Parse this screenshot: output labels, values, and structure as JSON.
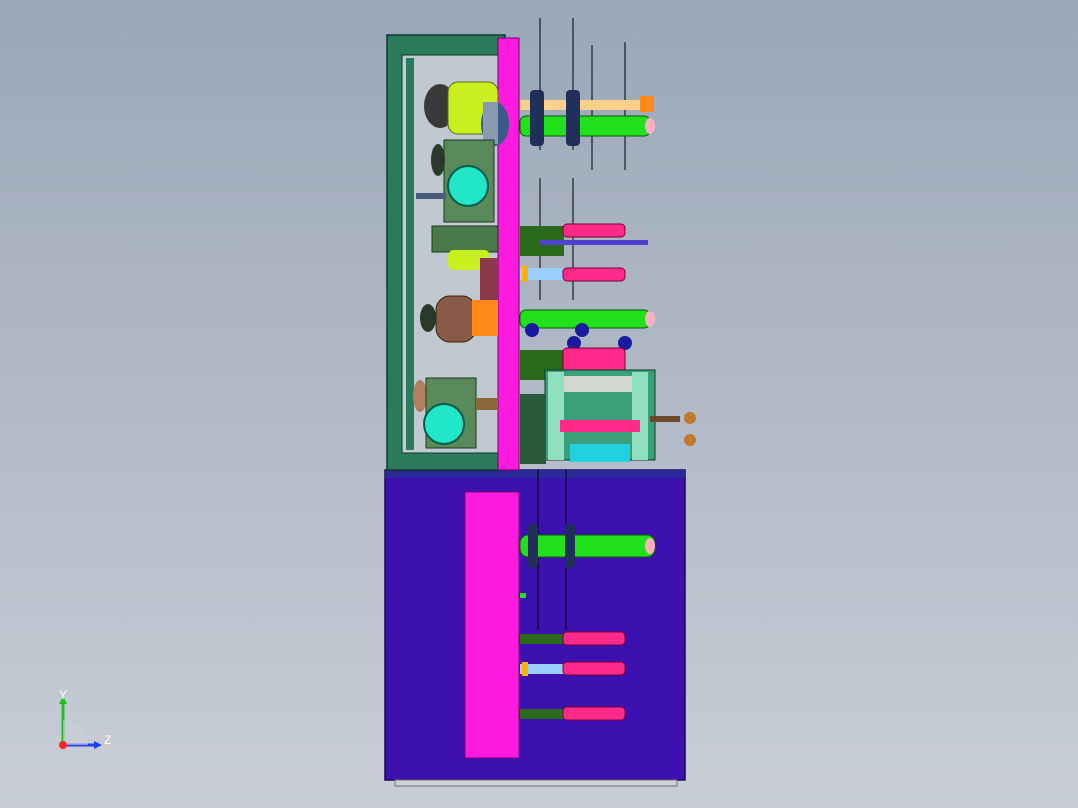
{
  "viewport": {
    "background_top": "#9aa7b8",
    "background_bottom": "#c9ced6"
  },
  "model": {
    "frame_color": "#2b7a5c",
    "cabinet_color": "#3d10b0",
    "panel_color": "#ff1ae0",
    "roller_green": "#22e01c",
    "roller_pink": "#ff2a8a",
    "motor_yellow": "#c9ef1e",
    "motor_cyan": "#22e6c8",
    "motor_housing": "#5a8a5a",
    "bronze": "#8a5a48",
    "orange": "#ff8a1a"
  },
  "triad": {
    "y_label": "Y",
    "z_label": "Z",
    "y_color": "#20c020",
    "z_color": "#2040ff",
    "x_color": "#ff2020"
  }
}
